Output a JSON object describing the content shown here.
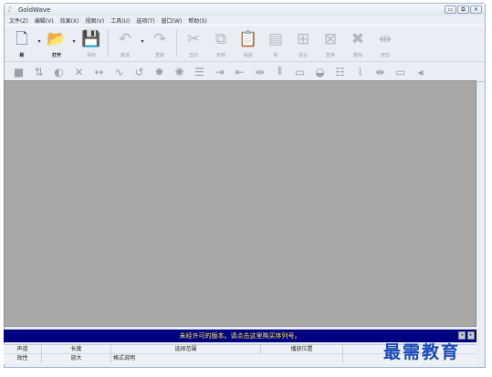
{
  "window": {
    "title": "GoldWave",
    "controls": [
      "▭",
      "⧉",
      "✕"
    ]
  },
  "menu": [
    "文件(Z)",
    "编辑(V)",
    "效果(X)",
    "视图(V)",
    "工具(U)",
    "选项(T)",
    "窗口(W)",
    "帮助(S)"
  ],
  "toolbar": {
    "buttons": [
      {
        "label": "新",
        "icon": "🗋",
        "enabled": true,
        "dropdown": true
      },
      {
        "label": "打开",
        "icon": "📂",
        "enabled": true,
        "dropdown": true
      },
      {
        "label": "保存",
        "icon": "💾",
        "enabled": false,
        "dropdown": false
      },
      {
        "label": "撤消",
        "icon": "↶",
        "enabled": false,
        "dropdown": true
      },
      {
        "label": "重做",
        "icon": "↷",
        "enabled": false,
        "dropdown": false
      },
      {
        "label": "剪切",
        "icon": "✂",
        "enabled": false,
        "dropdown": false
      },
      {
        "label": "复制",
        "icon": "⧉",
        "enabled": false,
        "dropdown": false
      },
      {
        "label": "粘贴",
        "icon": "📋",
        "enabled": false,
        "dropdown": false
      },
      {
        "label": "新",
        "icon": "▤",
        "enabled": false,
        "dropdown": false
      },
      {
        "label": "混合",
        "icon": "⊞",
        "enabled": false,
        "dropdown": false
      },
      {
        "label": "替换",
        "icon": "⊠",
        "enabled": false,
        "dropdown": false
      },
      {
        "label": "删除",
        "icon": "✖",
        "enabled": false,
        "dropdown": false
      },
      {
        "label": "修剪",
        "icon": "⇹",
        "enabled": false,
        "dropdown": false
      }
    ]
  },
  "effects_toolbar": [
    "■",
    "⇅",
    "◐",
    "✕",
    "↔",
    "∿",
    "↺",
    "✹",
    "✺",
    "☰",
    "⇥",
    "⇤",
    "⇹",
    "⫴",
    "▭",
    "◒",
    "☷",
    "⌇",
    "⇼",
    "▭",
    "◂"
  ],
  "banner": {
    "text": "未经许可的版本。请点击这里购买序列号。",
    "scroll": [
      "◂",
      "▸"
    ]
  },
  "status": {
    "row1": [
      "声道",
      "长度",
      "选择范围",
      "播放位置",
      ""
    ],
    "row2": [
      "改性",
      "放大",
      "格式说明",
      ""
    ]
  },
  "watermark": "最需教育"
}
